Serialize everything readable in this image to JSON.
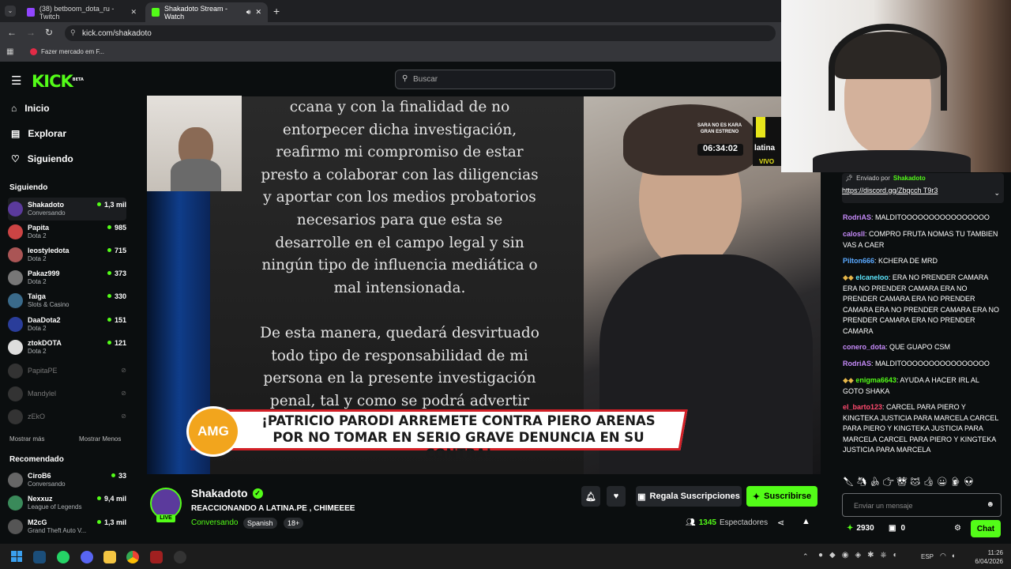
{
  "browser": {
    "tabs": [
      {
        "label": "(38) betboom_dota_ru - Twitch"
      },
      {
        "label": "Shakadoto Stream - Watch"
      }
    ],
    "url": "kick.com/shakadoto",
    "bookmark": "Fazer mercado em F..."
  },
  "kick": {
    "logo": "KICK",
    "logo_badge": "BETA",
    "search_placeholder": "Buscar",
    "nav": {
      "home": "Inicio",
      "explore": "Explorar",
      "following": "Siguiendo"
    },
    "following_title": "Siguiendo",
    "following": [
      {
        "name": "Shakadoto",
        "sub": "Conversando",
        "viewers": "1,3 mil"
      },
      {
        "name": "Papita",
        "sub": "Dota 2",
        "viewers": "985"
      },
      {
        "name": "leostyledota",
        "sub": "Dota 2",
        "viewers": "715"
      },
      {
        "name": "Pakaz999",
        "sub": "Dota 2",
        "viewers": "373"
      },
      {
        "name": "Taiga",
        "sub": "Slots & Casino",
        "viewers": "330"
      },
      {
        "name": "DaaDota2",
        "sub": "Dota 2",
        "viewers": "151"
      },
      {
        "name": "ztokDOTA",
        "sub": "Dota 2",
        "viewers": "121"
      }
    ],
    "offline": [
      {
        "name": "PapitaPE"
      },
      {
        "name": "Mandylel"
      },
      {
        "name": "zEkO"
      }
    ],
    "show_more": "Mostrar más",
    "show_less": "Mostrar Menos",
    "recommended_title": "Recomendado",
    "recommended": [
      {
        "name": "CiroB6",
        "sub": "Conversando",
        "viewers": "33"
      },
      {
        "name": "Nexxuz",
        "sub": "League of Legends",
        "viewers": "9,4 mil"
      },
      {
        "name": "M2cG",
        "sub": "Grand Theft Auto V...",
        "viewers": "1,3 mil"
      }
    ]
  },
  "video": {
    "doc_text": "ccana y con la finalidad de no\nentorpecer dicha investigación,\nreafirmo mi compromiso de estar\npresto a colaborar con las diligencias\ny aportar con los medios probatorios\nnecesarios para que esta se\ndesarrolle en el campo legal y sin\nningún tipo de influencia mediática o\nmal intensionada.\n\nDe esta manera, quedará desvirtuado\ntodo tipo de responsabilidad de mi\npersona en la presente investigación\npenal, tal y como se podrá advertir",
    "banner_logo": "AMG",
    "banner_text": "¡PATRICIO PARODI ARREMETE CONTRA PIERO ARENAS POR NO TOMAR EN SERIO GRAVE DENUNCIA EN SU CONTRA!",
    "promo": "SARA NO ES KARA GRAN ESTRENO",
    "clock": "06:34:02",
    "channel_logo": "latina",
    "live_tag": "VIVO"
  },
  "stream": {
    "channel": "Shakadoto",
    "live": "LIVE",
    "title": "REACCIONANDO A LATINA.PE , CHIMEEEE",
    "category": "Conversando",
    "tags": [
      "Spanish",
      "18+"
    ],
    "gift_label": "Regala Suscripciones",
    "subscribe_label": "Suscribirse",
    "viewers": "1345",
    "viewers_label": "Espectadores"
  },
  "chat": {
    "pinned_by": "Enviado por",
    "pinned_user": "Shakadoto",
    "pinned_link": "https://discord.gg/Zbqcch T9r3",
    "messages": [
      {
        "user": "RodriAS",
        "color": "#c58af9",
        "text": "MALDITOOOOOOOOOOOOOOOO"
      },
      {
        "user": "calosll",
        "color": "#c58af9",
        "text": "COMPRO FRUTA NOMAS TU TAMBIEN VAS A CAER"
      },
      {
        "user": "Pilton666",
        "color": "#5aa9ff",
        "text": "KCHERA DE MRD"
      },
      {
        "user": "elcaneloo",
        "color": "#5ee8ff",
        "text": "ERA NO PRENDER CAMARA ERA NO PRENDER CAMARA ERA NO PRENDER CAMARA ERA NO PRENDER CAMARA ERA NO PRENDER CAMARA ERA NO PRENDER CAMARA ERA NO PRENDER CAMARA"
      },
      {
        "user": "conero_dota",
        "color": "#c58af9",
        "text": "QUE GUAPO CSM"
      },
      {
        "user": "RodriAS",
        "color": "#c58af9",
        "text": "MALDITOOOOOOOOOOOOOOOO"
      },
      {
        "user": "enigma6643",
        "color": "#53fc18",
        "text": "AYUDA A HACER IRL AL GOTO SHAKA"
      },
      {
        "user": "el_barto123",
        "color": "#ff4a6e",
        "text": "CARCEL PARA PIERO Y KINGTEKA JUSTICIA PARA MARCELA CARCEL PARA PIERO Y KINGTEKA JUSTICIA PARA MARCELA CARCEL PARA PIERO Y KINGTEKA JUSTICIA PARA MARCELA"
      }
    ],
    "input_placeholder": "Enviar un mensaje",
    "points": "2930",
    "gifts": "0",
    "send_label": "Chat"
  },
  "taskbar": {
    "lang": "ESP",
    "time": "11:26",
    "date": "6/04/2026"
  }
}
